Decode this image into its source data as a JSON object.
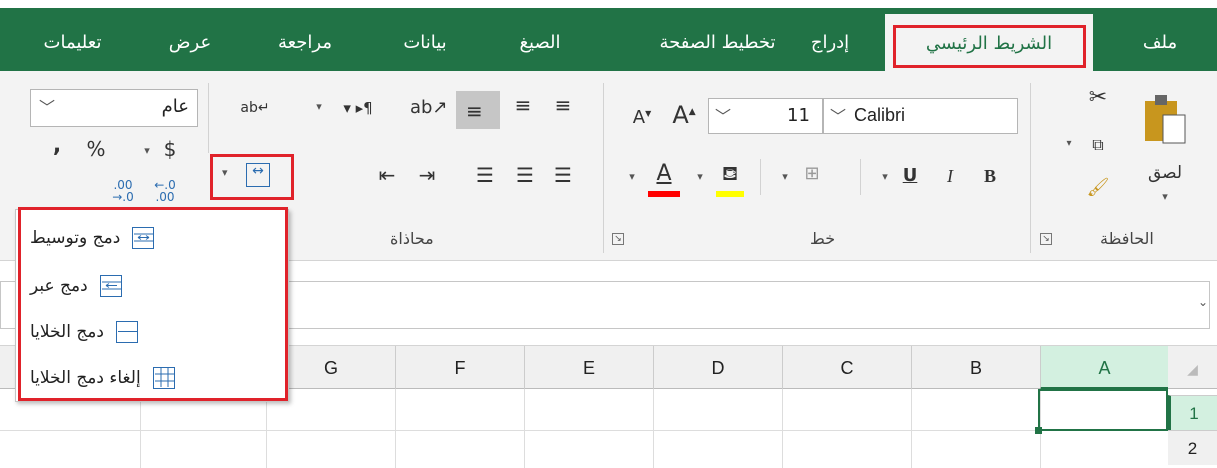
{
  "tabs": {
    "file": "ملف",
    "home": "الشريط الرئيسي",
    "insert": "إدراج",
    "page_layout": "تخطيط الصفحة",
    "formulas": "الصيغ",
    "data": "بيانات",
    "review": "مراجعة",
    "view": "عرض",
    "help": "تعليمات"
  },
  "clipboard": {
    "paste": "لصق",
    "group": "الحافظة"
  },
  "font": {
    "name": "Calibri",
    "size": "11",
    "group": "خط",
    "bold": "B",
    "italic": "I",
    "underline": "U"
  },
  "alignment": {
    "group": "محاذاة"
  },
  "number": {
    "format": "عام",
    "currency": "$",
    "percent": "%",
    "comma": ","
  },
  "merge_menu": {
    "items": [
      "دمج وتوسيط",
      "دمج عبر",
      "دمج الخلايا",
      "إلغاء دمج الخلايا"
    ]
  },
  "columns": [
    "A",
    "B",
    "C",
    "D",
    "E",
    "F",
    "G"
  ],
  "rows": [
    "1",
    "2"
  ],
  "colors": {
    "brand": "#217346",
    "highlight": "#e0222a",
    "font_color": "#ff0000",
    "fill_color": "#ffff00"
  }
}
